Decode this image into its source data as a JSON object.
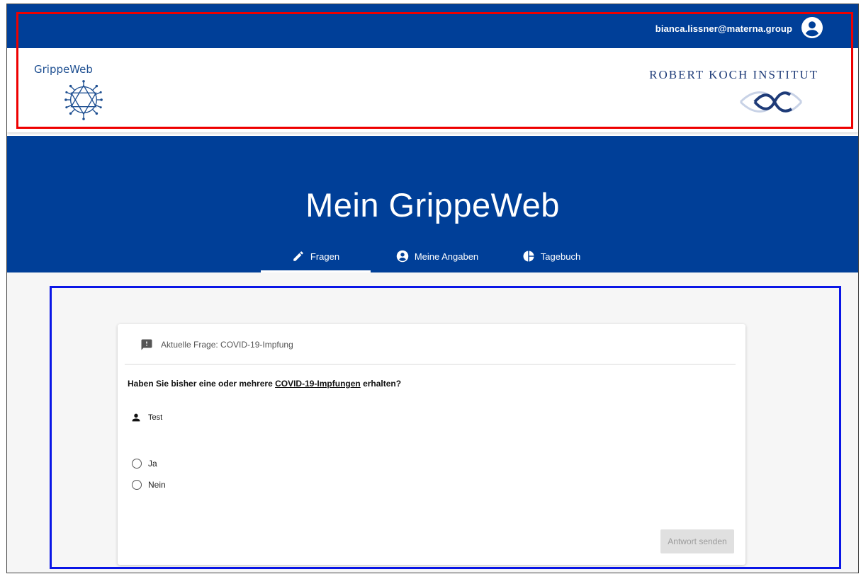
{
  "header": {
    "user_email": "bianca.lissner@materna.group",
    "brand_left": "GrippeWeb",
    "brand_right": "ROBERT KOCH INSTITUT"
  },
  "hero": {
    "title": "Mein GrippeWeb",
    "tabs": [
      {
        "label": "Fragen",
        "icon": "pencil-icon",
        "active": true
      },
      {
        "label": "Meine Angaben",
        "icon": "account-circle-icon",
        "active": false
      },
      {
        "label": "Tagebuch",
        "icon": "pie-chart-icon",
        "active": false
      }
    ]
  },
  "card": {
    "header": "Aktuelle Frage: COVID-19-Impfung",
    "question_prefix": "Haben Sie bisher eine oder mehrere ",
    "question_link": "COVID-19-Impfungen",
    "question_suffix": " erhalten?",
    "person": "Test",
    "options": [
      "Ja",
      "Nein"
    ],
    "submit_label": "Antwort senden"
  },
  "colors": {
    "primary": "#003f98",
    "highlight_red": "#ee0000",
    "highlight_blue": "#0a16e6",
    "disabled_button": "#e0e0e0"
  }
}
